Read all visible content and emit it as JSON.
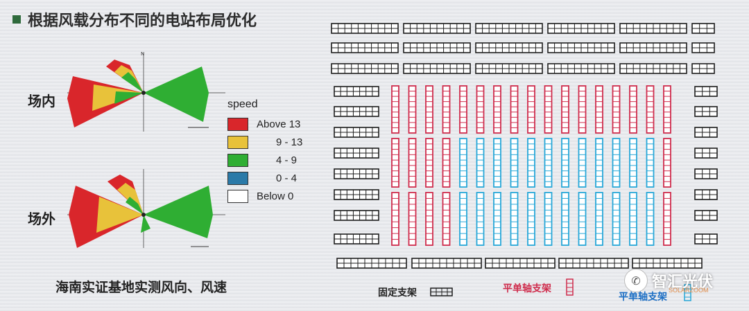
{
  "title": "根据风载分布不同的电站布局优化",
  "roses": {
    "inside_label": "场内",
    "outside_label": "场外",
    "north_mark": "N"
  },
  "legend": {
    "title": "speed",
    "items": [
      {
        "label": "Above 13",
        "color": "#d9262b"
      },
      {
        "label": "9 - 13",
        "color": "#e8c23a"
      },
      {
        "label": "4 - 9",
        "color": "#2fae33"
      },
      {
        "label": "0 - 4",
        "color": "#2b7aa8"
      },
      {
        "label": "Below 0",
        "color": "#ffffff"
      }
    ]
  },
  "caption": "海南实证基地实测风向、风速",
  "layout_legend": {
    "fixed_label": "固定支架",
    "tracker_label_1": "平单轴支架",
    "tracker_label_2": "平单轴支架"
  },
  "colors": {
    "tracker_red": "#cf2c4c",
    "tracker_blue": "#27a7d8",
    "fixed": "#1c1c1c"
  },
  "watermark": {
    "name": "智汇光伏",
    "sub": "SOLARZOOM",
    "icon": "wechat-icon"
  }
}
